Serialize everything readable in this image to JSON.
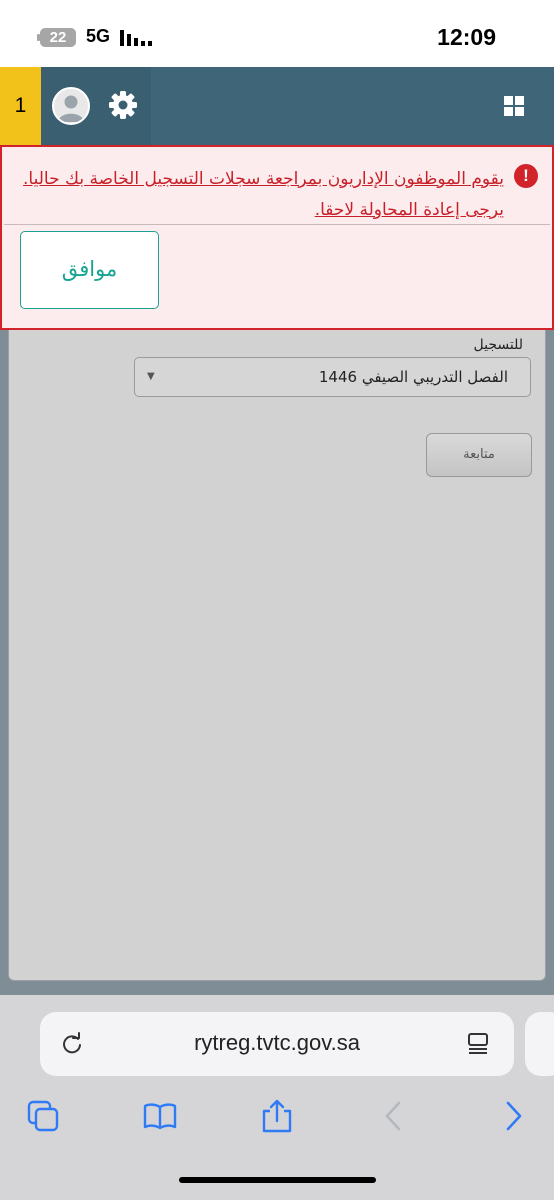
{
  "status_bar": {
    "battery_level": "22",
    "network": "5G",
    "time": "12:09"
  },
  "header": {
    "counter": "1",
    "icons": [
      "avatar",
      "gear-icon",
      "grid-icon"
    ]
  },
  "error_dialog": {
    "message": "يقوم الموظفون الإداريون بمراجعة سجلات التسجيل الخاصة بك حاليا. يرجى إعادة المحاولة لاحقا.",
    "ok_label": "موافق",
    "colors": {
      "border": "#d2232a",
      "text": "#c8202a",
      "background": "#fdeced",
      "button": "#17a592"
    }
  },
  "form": {
    "semester_label": "للتسجيل",
    "semester_value": "الفصل التدريبي الصيفي 1446",
    "continue_label": "متابعة"
  },
  "browser": {
    "url": "rytreg.tvtc.gov.sa",
    "toolbar_icons": [
      "tabs-icon",
      "bookmarks-icon",
      "share-icon",
      "back-icon",
      "forward-icon"
    ],
    "accent": "#2f7bf5"
  }
}
